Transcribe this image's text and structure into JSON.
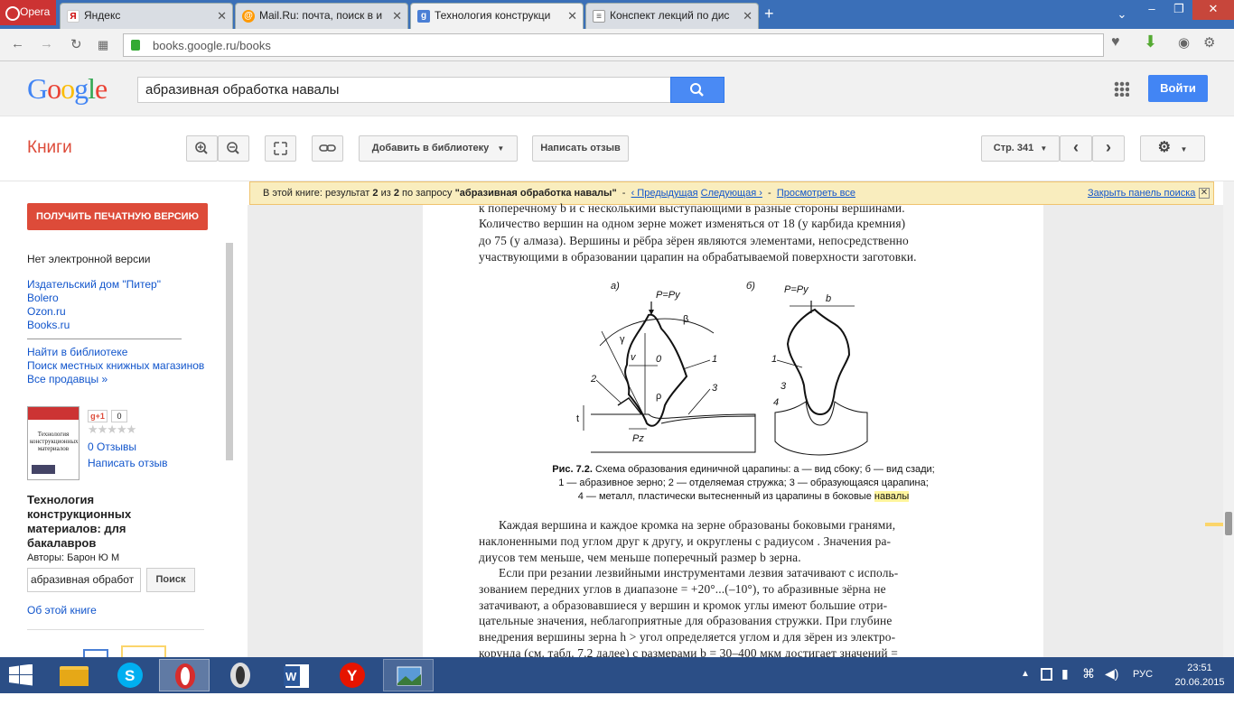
{
  "browser": {
    "menu_label": "Opera",
    "tabs": [
      {
        "title": "Яндекс",
        "icon": "yandex-icon",
        "active": false
      },
      {
        "title": "Mail.Ru: почта, поиск в и",
        "icon": "mailru-icon",
        "active": false
      },
      {
        "title": "Технология конструкци",
        "icon": "google-books-icon",
        "active": true
      },
      {
        "title": "Конспект лекций по дис",
        "icon": "document-icon",
        "active": false
      }
    ],
    "new_tab": "+",
    "url": "books.google.ru/books"
  },
  "google": {
    "logo": "Google",
    "search_value": "абразивная обработка навалы",
    "login_label": "Войти"
  },
  "books_toolbar": {
    "section_title": "Книги",
    "add_library_label": "Добавить в библиотеку",
    "write_review_label": "Написать отзыв",
    "page_label": "Стр. 341"
  },
  "notice": {
    "prefix": "В этой книге: результат",
    "current": "2",
    "of_word": "из",
    "total": "2",
    "query_prefix": "по запросу",
    "query": "\"абразивная обработка навалы\"",
    "sep": "-",
    "prev": "‹ Предыдущая",
    "next": "Следующая ›",
    "view_all": "Просмотреть все",
    "close_panel": "Закрыть панель поиска",
    "close_x": "✕"
  },
  "sidebar": {
    "print_button": "ПОЛУЧИТЬ ПЕЧАТНУЮ ВЕРСИЮ",
    "no_ebook": "Нет электронной версии",
    "sellers": [
      "Издательский дом \"Питер\"",
      "Bolero",
      "Ozon.ru",
      "Books.ru"
    ],
    "find_library": "Найти в библиотеке",
    "find_local": "Поиск местных книжных магазинов",
    "all_sellers": "Все продавцы »",
    "gplus": "g+1",
    "gplus_count": "0",
    "stars": "★★★★★",
    "reviews": "0 Отзывы",
    "write_review": "Написать отзыв",
    "cover_title": "Технология конструкционных материалов",
    "book_title": "Технология конструкционных материалов: для бакалавров",
    "authors": "Авторы: Барон Ю М",
    "search_value": "абразивная обработ",
    "search_button": "Поиск",
    "about": "Об этой книге"
  },
  "page": {
    "lines_top": [
      "к поперечному b и с несколькими выступающими в разные стороны вершинами.",
      "Количество вершин на одном зерне может изменяться от 18 (у карбида кремния)",
      "до 75 (у алмаза). Вершины и рёбра зёрен являются элементами, непосредственно",
      "участвующими в образовании царапин на обрабатываемой поверхности заготовки."
    ],
    "figure": {
      "label_a": "а)",
      "label_b": "б)",
      "force_a": "P=Py",
      "force_b": "P=Py",
      "beta": "β",
      "gamma": "γ",
      "v": "v",
      "zero": "0",
      "rho": "ρ",
      "pz": "Pz",
      "t": "t",
      "b": "b",
      "n1a": "1",
      "n2": "2",
      "n3a": "3",
      "n1b": "1",
      "n3b": "3",
      "n4": "4"
    },
    "caption": {
      "line1_bold": "Рис. 7.2.",
      "line1": "Схема образования единичной царапины: а — вид сбоку; б — вид сзади;",
      "line2": "1 — абразивное зерно; 2 — отделяемая стружка; 3 — образующаяся царапина;",
      "line3": "4 — металл, пластически вытесненный из царапины в боковые",
      "line3_hl": "навалы"
    },
    "lines_bottom": [
      "Каждая вершина и каждое кромка на зерне образованы боковыми гранями,",
      "наклоненными под углом   друг к другу, и округлены с радиусом  . Значения ра-",
      "диусов   тем меньше, чем меньше поперечный размер b зерна.",
      "Если при резании лезвийными инструментами лезвия затачивают с исполь-",
      "зованием передних углов в диапазоне   = +20°...(–10°), то абразивные зёрна не",
      "затачивают, а образовавшиеся у вершин и кромок углы   имеют большие отри-",
      "цательные значения, неблагоприятные для образования стружки. При глубине",
      "внедрения вершины зерна h >   угол   определяется углом   и для зёрен из электро-",
      "корунда (см. табл. 7.2 далее) с размерами b = 30–400 мкм достигает значений   ="
    ]
  },
  "taskbar": {
    "apps": [
      "explorer-icon",
      "skype-icon",
      "opera-icon",
      "opera-next-icon",
      "word-icon",
      "yandex-browser-icon",
      "photo-viewer-icon"
    ],
    "lang": "РУС",
    "time": "23:51",
    "date": "20.06.2015"
  }
}
